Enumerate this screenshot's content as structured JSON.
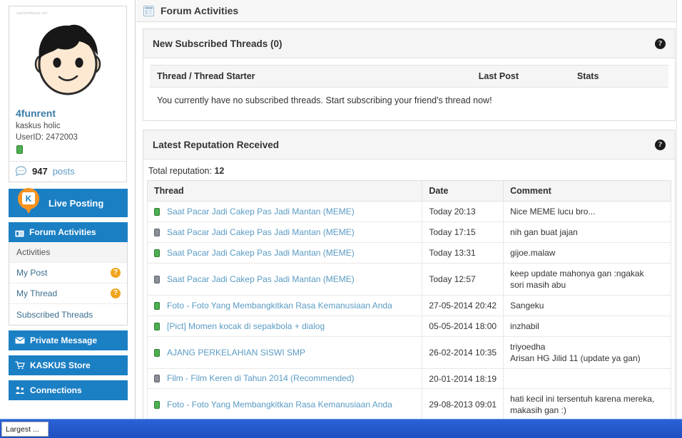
{
  "window": {
    "taskbar_button_label": "Largest ..."
  },
  "sidebar": {
    "profile": {
      "watermark": "cartoonfaces.net",
      "avatar_icon": "cartoon-face-avatar",
      "username": "4funrent",
      "usertitle": "kaskus holic",
      "userid_label": "UserID: 2472003",
      "reputation_icon": "green-reputation-block",
      "posts_icon": "comment-bubble-icon",
      "posts_count": "947",
      "posts_label": "posts"
    },
    "live_posting": {
      "label": "Live Posting",
      "icon": "kaskus-pin-icon"
    },
    "forum_activities": {
      "label": "Forum Activities",
      "icon": "forum-window-icon",
      "items": [
        {
          "label": "Activities",
          "badge": "",
          "active": true
        },
        {
          "label": "My Post",
          "badge": "?",
          "active": false
        },
        {
          "label": "My Thread",
          "badge": "?",
          "active": false
        },
        {
          "label": "Subscribed Threads",
          "badge": "",
          "active": false
        }
      ]
    },
    "other_nav": [
      {
        "label": "Private Message",
        "icon": "envelope-icon"
      },
      {
        "label": "KASKUS Store",
        "icon": "shopping-cart-icon"
      },
      {
        "label": "Connections",
        "icon": "connections-icon"
      }
    ]
  },
  "main": {
    "header": {
      "title": "Forum Activities",
      "icon": "page-window-icon"
    },
    "subscribed_panel": {
      "title": "New Subscribed Threads (0)",
      "help_icon": "help-question-icon",
      "help_glyph": "?",
      "columns": [
        "Thread / Thread Starter",
        "Last Post",
        "Stats"
      ],
      "empty_message": "You currently have no subscribed threads. Start subscribing your friend's thread now!"
    },
    "reputation_panel": {
      "title": "Latest Reputation Received",
      "help_icon": "help-question-icon",
      "help_glyph": "?",
      "total_label": "Total reputation:",
      "total_value": "12",
      "columns": [
        "Thread",
        "Date",
        "Comment"
      ],
      "rows": [
        {
          "status": "green",
          "thread": "Saat Pacar Jadi Cakep Pas Jadi Mantan (MEME)",
          "date": "Today 20:13",
          "comment": [
            "Nice MEME lucu bro..."
          ]
        },
        {
          "status": "gray",
          "thread": "Saat Pacar Jadi Cakep Pas Jadi Mantan (MEME)",
          "date": "Today 17:15",
          "comment": [
            "nih gan buat jajan"
          ]
        },
        {
          "status": "green",
          "thread": "Saat Pacar Jadi Cakep Pas Jadi Mantan (MEME)",
          "date": "Today 13:31",
          "comment": [
            "gijoe.malaw"
          ]
        },
        {
          "status": "gray",
          "thread": "Saat Pacar Jadi Cakep Pas Jadi Mantan (MEME)",
          "date": "Today 12:57",
          "comment": [
            "keep update mahonya gan :ngakak",
            "sori masih abu"
          ]
        },
        {
          "status": "green",
          "thread": "Foto - Foto Yang Membangkitkan Rasa Kemanusiaan Anda",
          "date": "27-05-2014 20:42",
          "comment": [
            "Sangeku"
          ]
        },
        {
          "status": "green",
          "thread": "[Pict] Momen kocak di sepakbola + dialog",
          "date": "05-05-2014 18:00",
          "comment": [
            "inzhabil"
          ]
        },
        {
          "status": "green",
          "thread": "AJANG PERKELAHIAN SISWI SMP",
          "date": "26-02-2014 10:35",
          "comment": [
            "triyoedha",
            "Arisan HG Jilid 11 (update ya gan)"
          ]
        },
        {
          "status": "gray",
          "thread": "Film - Film Keren di Tahun 2014 (Recommended)",
          "date": "20-01-2014 18:19",
          "comment": [
            ""
          ]
        },
        {
          "status": "green",
          "thread": "Foto - Foto Yang Membangkitkan Rasa Kemanusiaan Anda",
          "date": "29-08-2013 09:01",
          "comment": [
            "hati kecil ini tersentuh karena mereka,",
            "makasih gan :)"
          ]
        }
      ]
    }
  },
  "colors": {
    "brand_blue": "#1b7fc4",
    "link_blue": "#5a9bc4",
    "badge_orange": "#f0a51e",
    "status_green": "#4caf50",
    "status_gray": "#8b8f9a",
    "taskbar_blue": "#2a62d6"
  }
}
